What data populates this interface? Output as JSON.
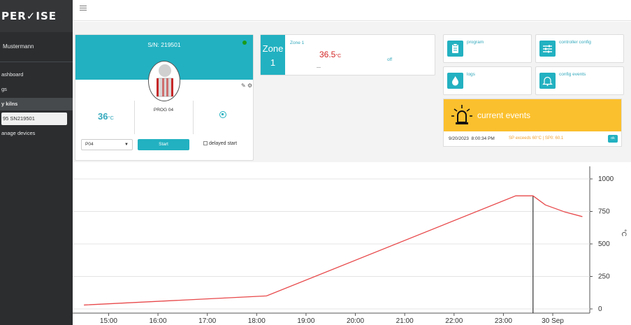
{
  "brand": {
    "logo_text": "PER✓ISE"
  },
  "sidebar": {
    "user": "Mustermann",
    "items": [
      {
        "label": "ashboard"
      },
      {
        "label": "gs"
      },
      {
        "label": "y kilns"
      },
      {
        "label": "95 SN219501"
      },
      {
        "label": "anage devices"
      }
    ]
  },
  "topbar": {
    "menu_icon": "hamburger-icon"
  },
  "kiln": {
    "serial": "S/N: 219501",
    "status_color": "#1a9b1a",
    "temperature": "36",
    "temp_unit": "°C",
    "program_name": "PROG 04",
    "program_select_value": "P04",
    "start_label": "Start",
    "delayed_label": "delayed start"
  },
  "zone": {
    "badge_word": "Zone",
    "badge_number": "1",
    "label": "Zone 1",
    "temperature": "36.5",
    "temp_unit": "°C",
    "setpoint": "---",
    "state": "off"
  },
  "tiles": {
    "program": "program",
    "controller_config": "controller config",
    "logs": "logs",
    "config_events": "config events"
  },
  "events": {
    "title": "current events",
    "date": "9/20/2023",
    "time": "8:00:34 PM",
    "message": "SP exceeds 60°C | SP0: 60.1",
    "ok_label": "ok"
  },
  "colors": {
    "accent": "#22b1c1",
    "warning": "#fbc02d",
    "sidebar_bg": "#2b2d2f",
    "temp_red": "#d32424",
    "curve_red": "#e8484a"
  },
  "chart_data": {
    "type": "line",
    "x_labels": [
      "15:00",
      "16:00",
      "17:00",
      "18:00",
      "19:00",
      "20:00",
      "21:00",
      "22:00",
      "23:00",
      "30 Sep"
    ],
    "y_ticks": [
      0,
      250,
      500,
      750,
      1000
    ],
    "ylabel": "°C",
    "ylim": [
      0,
      1000
    ],
    "grid": true,
    "series": [
      {
        "color": "#e8484a",
        "x": [
          14.5,
          18.2,
          23.25,
          23.6,
          23.85,
          24.25,
          24.6
        ],
        "values": [
          30,
          100,
          870,
          870,
          800,
          745,
          710
        ]
      }
    ],
    "marker_x": 23.6
  }
}
